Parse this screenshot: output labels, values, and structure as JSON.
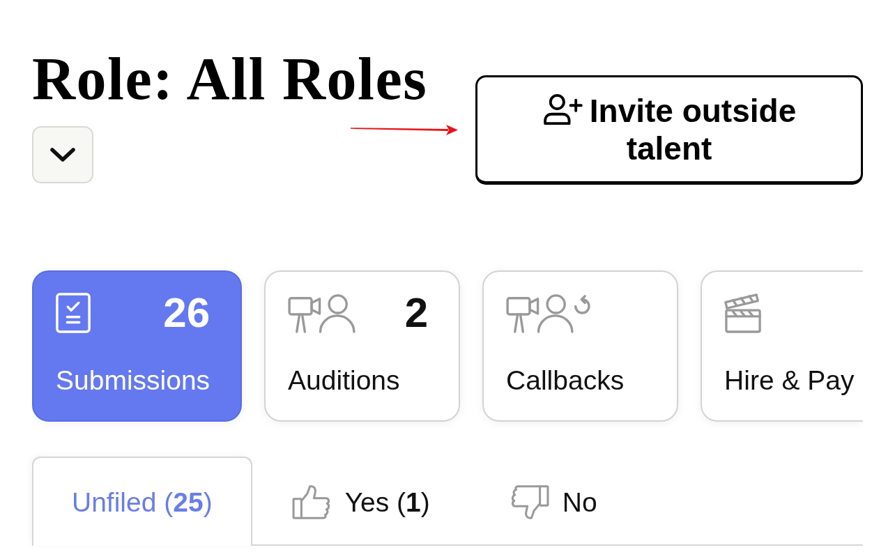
{
  "header": {
    "title": "Role: All Roles",
    "invite_button": {
      "label": "Invite outside talent"
    }
  },
  "stages": [
    {
      "kind": "submissions",
      "label": "Submissions",
      "count": "26",
      "selected": true
    },
    {
      "kind": "auditions",
      "label": "Auditions",
      "count": "2",
      "selected": false
    },
    {
      "kind": "callbacks",
      "label": "Callbacks",
      "selected": false
    },
    {
      "kind": "hire",
      "label": "Hire & Pay",
      "selected": false
    }
  ],
  "filter_tabs": [
    {
      "kind": "unfiled",
      "label": "Unfiled (**25**)",
      "selected": true
    },
    {
      "kind": "yes",
      "label": "Yes (**1**)",
      "selected": false
    },
    {
      "kind": "no",
      "label": "No",
      "selected": false
    }
  ]
}
